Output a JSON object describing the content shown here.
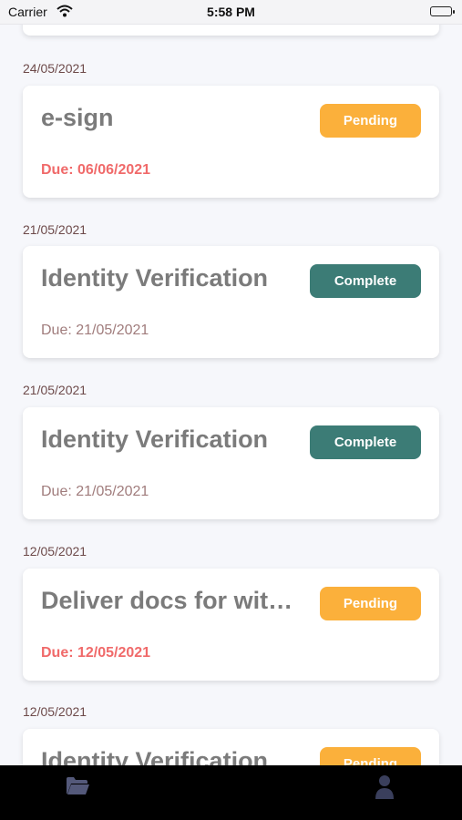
{
  "status_bar": {
    "carrier": "Carrier",
    "time": "5:58 PM"
  },
  "tasks": [
    {
      "date": "24/05/2021",
      "title": "e-sign",
      "status": "Pending",
      "due": "Due: 06/06/2021"
    },
    {
      "date": "21/05/2021",
      "title": "Identity Verification",
      "status": "Complete",
      "due": "Due: 21/05/2021"
    },
    {
      "date": "21/05/2021",
      "title": "Identity Verification",
      "status": "Complete",
      "due": "Due: 21/05/2021"
    },
    {
      "date": "12/05/2021",
      "title": "Deliver docs for witnessing",
      "status": "Pending",
      "due": "Due: 12/05/2021"
    },
    {
      "date": "12/05/2021",
      "title": "Identity Verification",
      "status": "Pending",
      "due": ""
    }
  ],
  "tab_bar": {
    "items": [
      {
        "icon": "folder-icon"
      },
      {
        "icon": "user-icon"
      }
    ]
  },
  "colors": {
    "pending": "#fbb03b",
    "complete": "#3c7c76",
    "overdue": "#f06a6a",
    "tab_icon": "#54597a"
  }
}
